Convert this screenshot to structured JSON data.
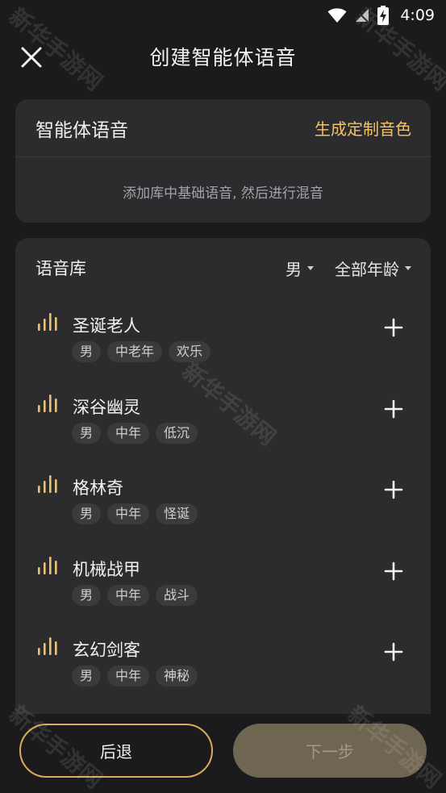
{
  "status_bar": {
    "time": "4:09"
  },
  "header": {
    "title": "创建智能体语音"
  },
  "voice_card": {
    "label": "智能体语音",
    "generate_link": "生成定制音色",
    "hint": "添加库中基础语音, 然后进行混音"
  },
  "library": {
    "label": "语音库",
    "filter_gender": "男",
    "filter_age": "全部年龄",
    "items": [
      {
        "name": "圣诞老人",
        "tags": [
          "男",
          "中老年",
          "欢乐"
        ]
      },
      {
        "name": "深谷幽灵",
        "tags": [
          "男",
          "中年",
          "低沉"
        ]
      },
      {
        "name": "格林奇",
        "tags": [
          "男",
          "中年",
          "怪诞"
        ]
      },
      {
        "name": "机械战甲",
        "tags": [
          "男",
          "中年",
          "战斗"
        ]
      },
      {
        "name": "玄幻剑客",
        "tags": [
          "男",
          "中年",
          "神秘"
        ]
      }
    ]
  },
  "footer": {
    "back_label": "后退",
    "next_label": "下一步"
  },
  "watermark": "新华手游网",
  "colors": {
    "accent": "#f0c46a",
    "bars": "#e8c27a",
    "background": "#1b1b1d",
    "card": "#2c2c2f"
  },
  "icons": {
    "close": "close-icon",
    "add": "plus-icon",
    "voice": "sound-bars-icon"
  }
}
